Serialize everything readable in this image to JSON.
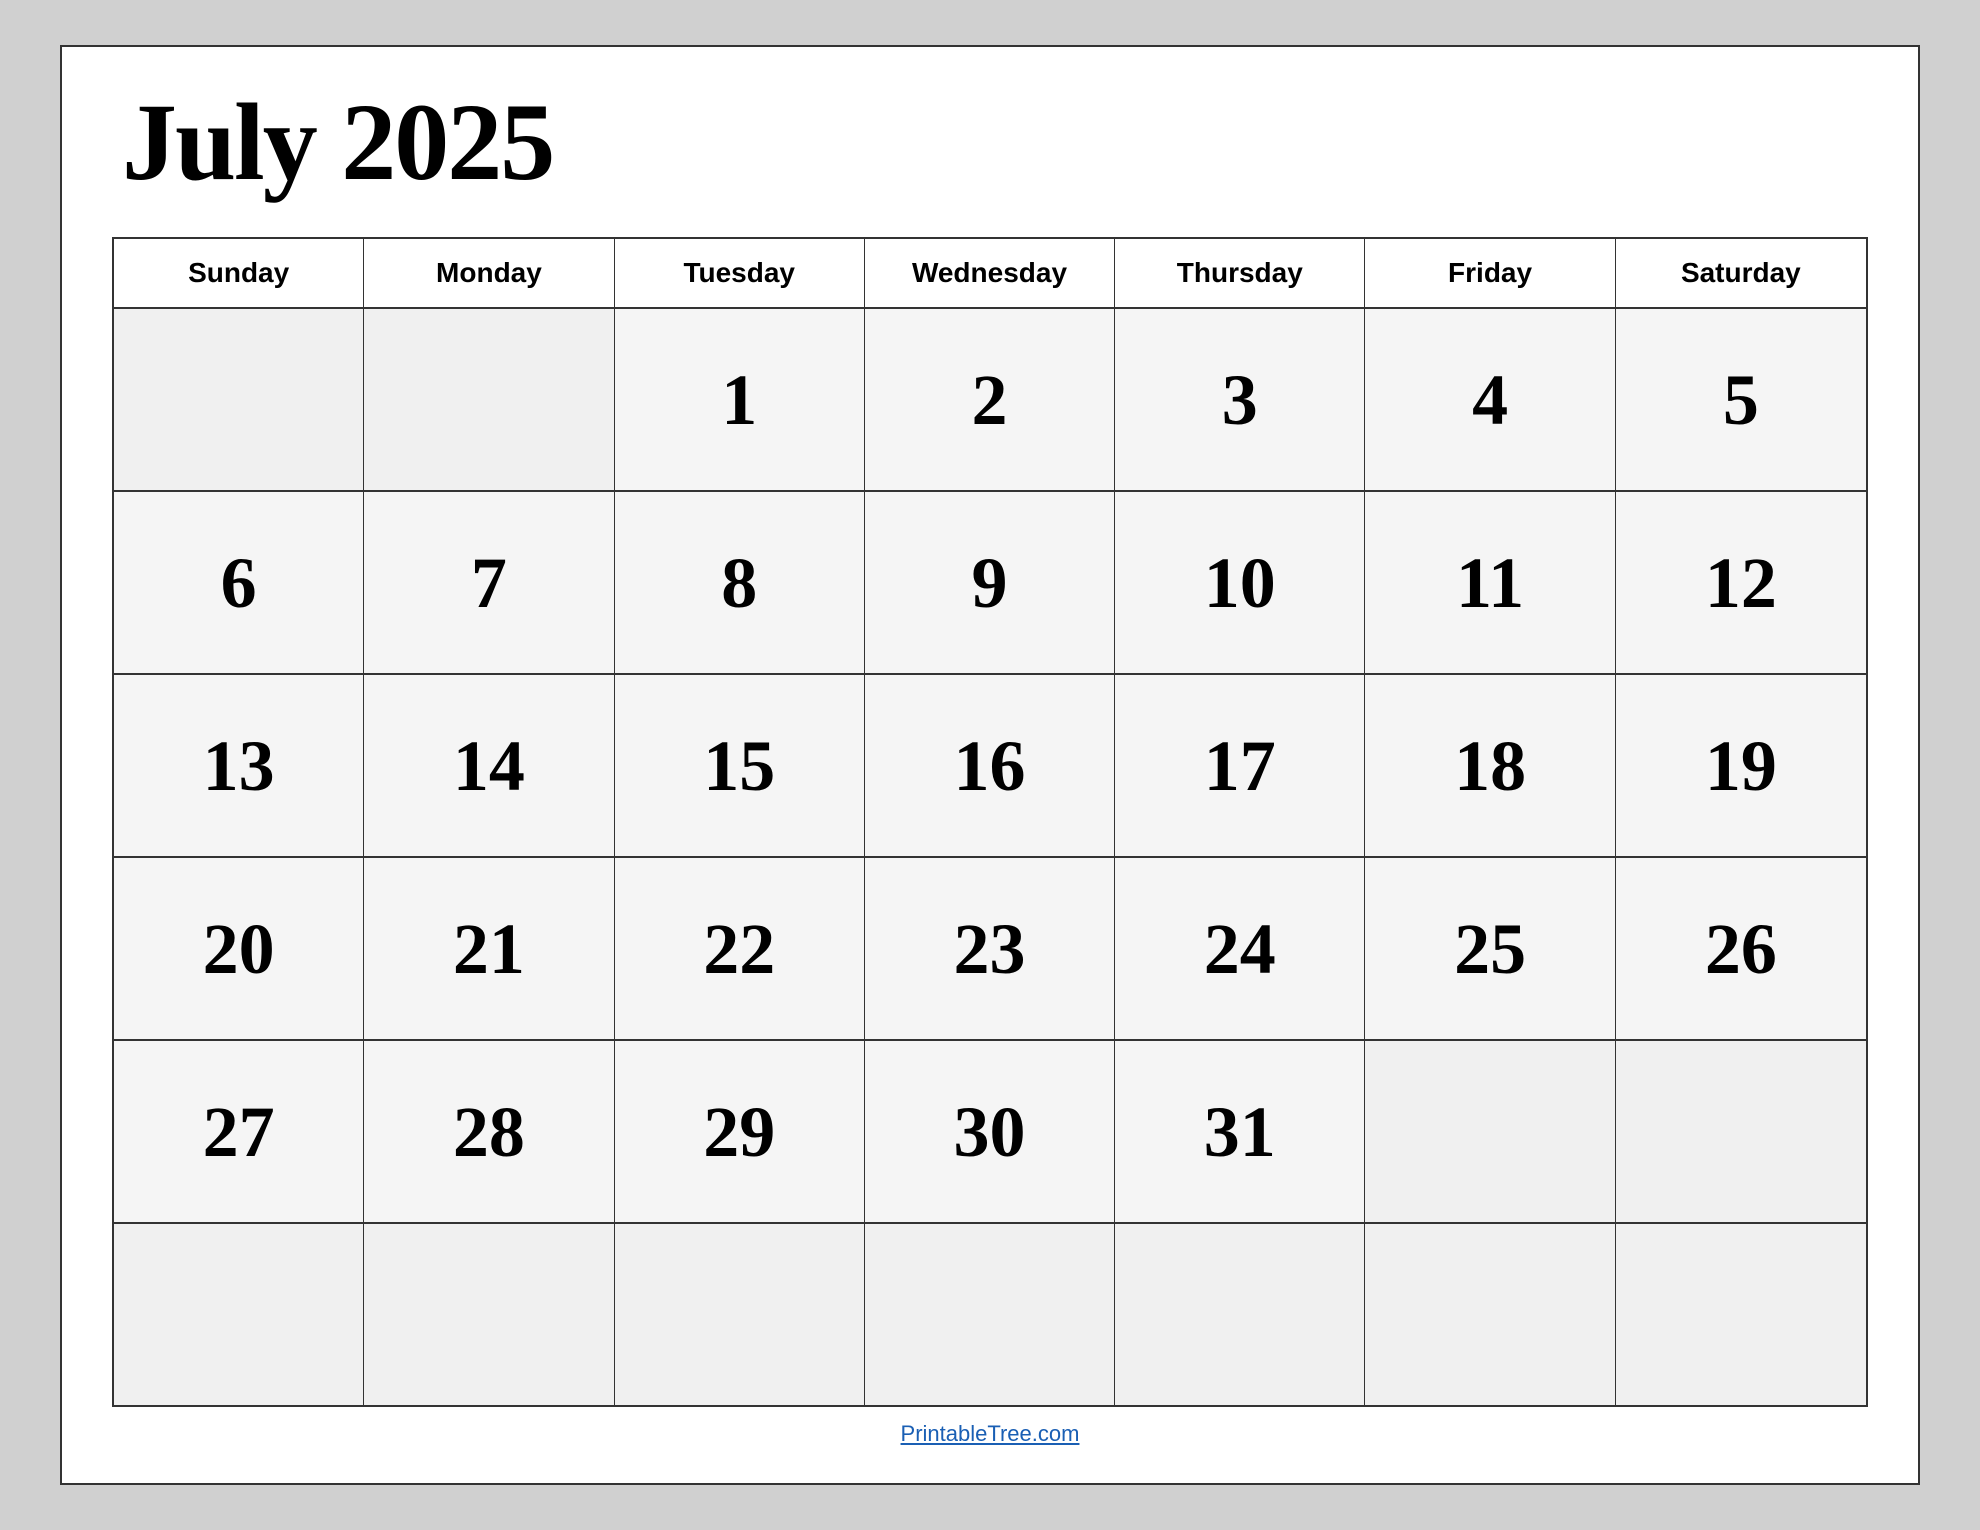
{
  "calendar": {
    "title": "July 2025",
    "month": "July",
    "year": "2025",
    "day_headers": [
      "Sunday",
      "Monday",
      "Tuesday",
      "Wednesday",
      "Thursday",
      "Friday",
      "Saturday"
    ],
    "weeks": [
      [
        null,
        null,
        1,
        2,
        3,
        4,
        5
      ],
      [
        6,
        7,
        8,
        9,
        10,
        11,
        12
      ],
      [
        13,
        14,
        15,
        16,
        17,
        18,
        19
      ],
      [
        20,
        21,
        22,
        23,
        24,
        25,
        26
      ],
      [
        27,
        28,
        29,
        30,
        31,
        null,
        null
      ],
      [
        null,
        null,
        null,
        null,
        null,
        null,
        null
      ]
    ]
  },
  "footer": {
    "link_text": "PrintableTree.com",
    "link_url": "https://PrintableTree.com"
  }
}
